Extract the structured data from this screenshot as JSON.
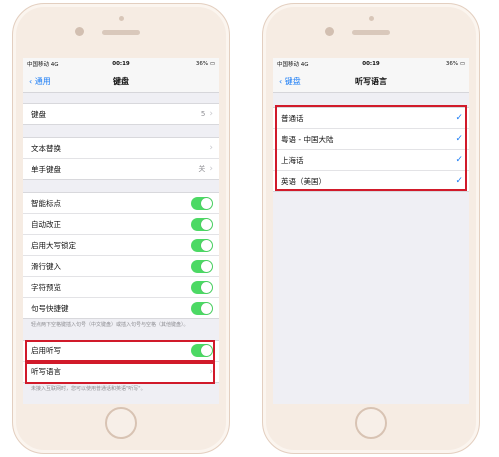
{
  "left": {
    "status": {
      "carrier": "中国移动 4G",
      "time": "00:19",
      "battery": "36%"
    },
    "nav": {
      "back": "通用",
      "title": "键盘"
    },
    "rows": {
      "keyboards": {
        "label": "键盘",
        "value": "5"
      },
      "text_replace": {
        "label": "文本替换"
      },
      "one_hand": {
        "label": "单手键盘",
        "value": "关"
      },
      "smart_punct": {
        "label": "智能标点"
      },
      "auto_correct": {
        "label": "自动改正"
      },
      "caps_lock": {
        "label": "启用大写锁定"
      },
      "slide_type": {
        "label": "滑行键入"
      },
      "char_preview": {
        "label": "字符预览"
      },
      "period_shortcut": {
        "label": "句号快捷键"
      },
      "enable_dictation": {
        "label": "启用听写"
      },
      "dictation_lang": {
        "label": "听写语言"
      }
    },
    "notes": {
      "period": "轻点两下空格键插入句号（中文键盘）或插入句号与空格（其他键盘）。",
      "dictation": "未接入互联网时，您可以使用普通话和英语\"听写\"。"
    }
  },
  "right": {
    "status": {
      "carrier": "中国移动 4G",
      "time": "00:19",
      "battery": "36%"
    },
    "nav": {
      "back": "键盘",
      "title": "听写语言"
    },
    "languages": [
      {
        "label": "普通话",
        "checked": true
      },
      {
        "label": "粤语 - 中国大陆",
        "checked": true
      },
      {
        "label": "上海话",
        "checked": true
      },
      {
        "label": "英语（美国）",
        "checked": true
      }
    ]
  },
  "colors": {
    "accent": "#1a7cf5",
    "toggle_on": "#4cd964",
    "highlight": "#d11a2a"
  },
  "icons": {
    "check": "checkmark-icon",
    "chevron": "chevron-right-icon",
    "back": "chevron-left-icon"
  }
}
